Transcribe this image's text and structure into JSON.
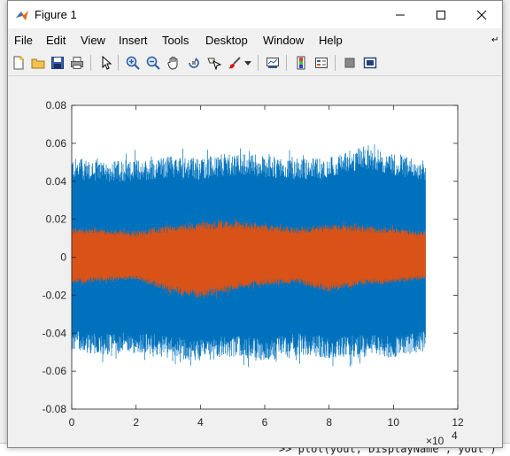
{
  "window": {
    "title": "Figure 1"
  },
  "menu": {
    "items": [
      "File",
      "Edit",
      "View",
      "Insert",
      "Tools",
      "Desktop",
      "Window",
      "Help"
    ]
  },
  "toolbar": {
    "icons": [
      "new-figure-icon",
      "open-file-icon",
      "save-icon",
      "print-icon",
      "edit-plot-arrow-icon",
      "zoom-in-icon",
      "zoom-out-icon",
      "pan-hand-icon",
      "rotate-3d-icon",
      "data-cursor-icon",
      "brush-icon",
      "brush-dropdown-icon",
      "link-plot-icon",
      "insert-colorbar-icon",
      "insert-legend-icon",
      "hide-plot-tools-icon",
      "show-plot-tools-icon"
    ]
  },
  "background": {
    "command_line": ">> plot(yout,'DisplayName','yout')"
  },
  "colors": {
    "series1": "#0072bd",
    "series2": "#d95319"
  },
  "chart_data": {
    "type": "line",
    "title": "",
    "xlabel": "",
    "ylabel": "",
    "x_exponent_label": "×10",
    "x_exponent": "4",
    "xlim": [
      0,
      12
    ],
    "ylim": [
      -0.08,
      0.08
    ],
    "x_ticks": [
      0,
      2,
      4,
      6,
      8,
      10,
      12
    ],
    "x_tick_labels": [
      "0",
      "2",
      "4",
      "6",
      "8",
      "10",
      "12"
    ],
    "y_ticks": [
      0.08,
      0.06,
      0.04,
      0.02,
      0,
      -0.02,
      -0.04,
      -0.06,
      -0.08
    ],
    "y_tick_labels": [
      "0.08",
      "0.06",
      "0.04",
      "0.02",
      "0",
      "-0.02",
      "-0.04",
      "-0.06",
      "-0.08"
    ],
    "x_data_max": 11,
    "series": [
      {
        "color": "#0072bd",
        "envelope": [
          {
            "x": 0,
            "lower": -0.054,
            "upper": 0.057
          },
          {
            "x": 1,
            "lower": -0.056,
            "upper": 0.055
          },
          {
            "x": 2,
            "lower": -0.055,
            "upper": 0.056
          },
          {
            "x": 3,
            "lower": -0.058,
            "upper": 0.058
          },
          {
            "x": 4,
            "lower": -0.06,
            "upper": 0.057
          },
          {
            "x": 5,
            "lower": -0.057,
            "upper": 0.06
          },
          {
            "x": 6,
            "lower": -0.06,
            "upper": 0.058
          },
          {
            "x": 7,
            "lower": -0.056,
            "upper": 0.057
          },
          {
            "x": 8,
            "lower": -0.058,
            "upper": 0.057
          },
          {
            "x": 9,
            "lower": -0.057,
            "upper": 0.064
          },
          {
            "x": 10,
            "lower": -0.058,
            "upper": 0.06
          },
          {
            "x": 11,
            "lower": -0.054,
            "upper": 0.055
          }
        ]
      },
      {
        "color": "#d95319",
        "envelope": [
          {
            "x": 0,
            "lower": -0.015,
            "upper": 0.017
          },
          {
            "x": 1,
            "lower": -0.014,
            "upper": 0.016
          },
          {
            "x": 2,
            "lower": -0.013,
            "upper": 0.015
          },
          {
            "x": 3,
            "lower": -0.02,
            "upper": 0.018
          },
          {
            "x": 4,
            "lower": -0.024,
            "upper": 0.02
          },
          {
            "x": 5,
            "lower": -0.019,
            "upper": 0.021
          },
          {
            "x": 6,
            "lower": -0.016,
            "upper": 0.019
          },
          {
            "x": 7,
            "lower": -0.015,
            "upper": 0.017
          },
          {
            "x": 8,
            "lower": -0.02,
            "upper": 0.019
          },
          {
            "x": 9,
            "lower": -0.016,
            "upper": 0.018
          },
          {
            "x": 10,
            "lower": -0.015,
            "upper": 0.017
          },
          {
            "x": 11,
            "lower": -0.013,
            "upper": 0.015
          }
        ]
      }
    ]
  }
}
